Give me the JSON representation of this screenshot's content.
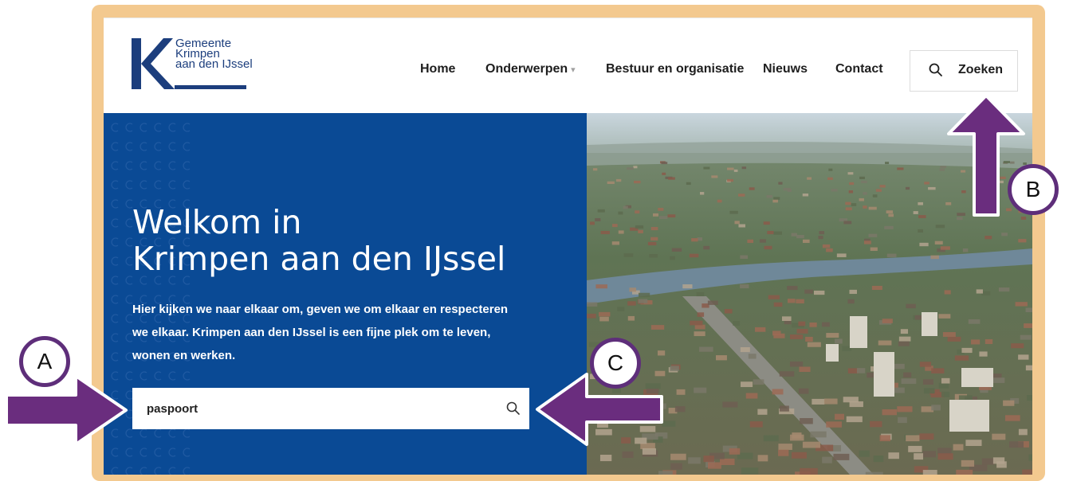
{
  "logo": {
    "line1": "Gemeente",
    "line2": "Krimpen",
    "line3": "aan den IJssel",
    "letter": "K"
  },
  "nav": {
    "items": [
      {
        "label": "Home"
      },
      {
        "label": "Onderwerpen"
      },
      {
        "label": "Bestuur en organisatie"
      },
      {
        "label": "Nieuws"
      },
      {
        "label": "Contact"
      }
    ],
    "search_label": "Zoeken"
  },
  "hero": {
    "title_line1": "Welkom in",
    "title_line2": "Krimpen aan den IJssel",
    "text": "Hier kijken we naar elkaar om, geven we om elkaar en respecteren we elkaar. Krimpen aan den IJssel is een fijne plek om te leven, wonen en werken.",
    "search_value": "paspoort"
  },
  "markers": {
    "a": "A",
    "b": "B",
    "c": "C"
  },
  "colors": {
    "brand_blue": "#0a4a95",
    "logo_blue": "#1c3e7d",
    "frame": "#f3c98f",
    "arrow": "#6a2d7e"
  },
  "icons": [
    "search-icon",
    "chevron-down-icon"
  ]
}
